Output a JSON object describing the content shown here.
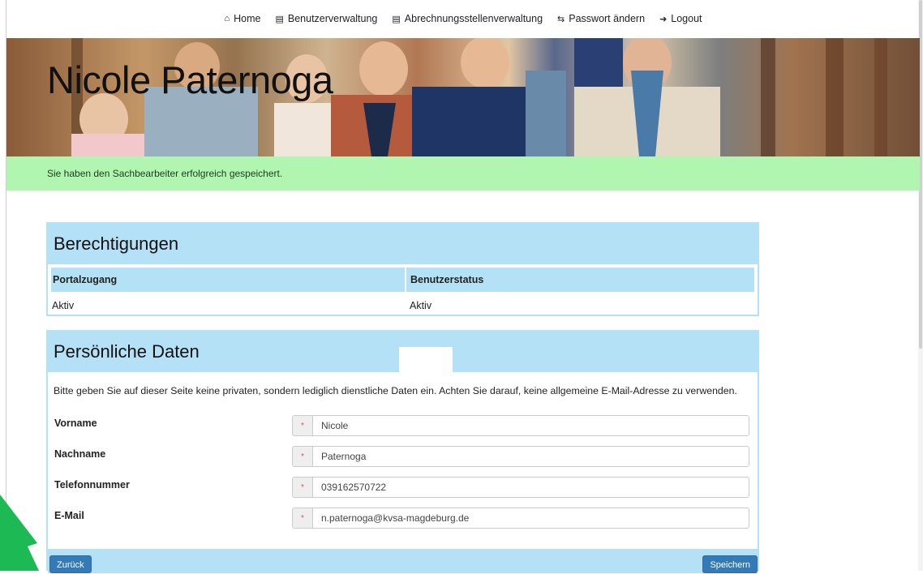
{
  "nav": {
    "items": [
      {
        "label": "Home",
        "icon": "home-icon"
      },
      {
        "label": "Benutzerverwaltung",
        "icon": "list-icon"
      },
      {
        "label": "Abrechnungsstellenverwaltung",
        "icon": "list-icon"
      },
      {
        "label": "Passwort ändern",
        "icon": "retweet-icon"
      },
      {
        "label": "Logout",
        "icon": "logout-icon"
      }
    ]
  },
  "header": {
    "title": "Nicole Paternoga"
  },
  "alert": {
    "message": "Sie haben den Sachbearbeiter erfolgreich gespeichert.",
    "color": "#b0f5b0"
  },
  "permissions": {
    "title": "Berechtigungen",
    "columns": [
      "Portalzugang",
      "Benutzerstatus"
    ],
    "rows": [
      [
        "Aktiv",
        "Aktiv"
      ]
    ]
  },
  "personal": {
    "title": "Persönliche Daten",
    "notice": "Bitte geben Sie auf dieser Seite keine privaten, sondern lediglich dienstliche Daten ein. Achten Sie darauf, keine allgemeine E-Mail-Adresse zu verwenden.",
    "required_marker": "*",
    "fields": [
      {
        "label": "Vorname",
        "value": "Nicole"
      },
      {
        "label": "Nachname",
        "value": "Paternoga"
      },
      {
        "label": "Telefonnummer",
        "value": "039162570722"
      },
      {
        "label": "E-Mail",
        "value": "n.paternoga@kvsa-magdeburg.de"
      }
    ],
    "back_label": "Zurück",
    "save_label": "Speichern"
  },
  "colors": {
    "panel_accent": "#b4e1f6",
    "button_primary": "#337ab7",
    "required": "#d9534f",
    "arrow": "#1db954"
  }
}
